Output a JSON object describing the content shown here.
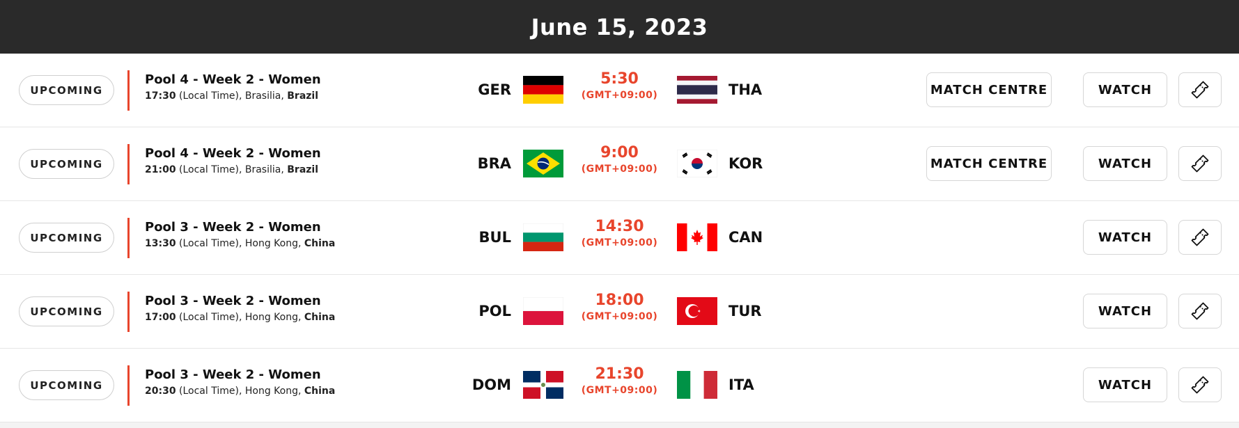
{
  "header": {
    "date": "June 15, 2023"
  },
  "labels": {
    "local_time": "(Local Time)",
    "match_centre": "MATCH CENTRE",
    "watch": "WATCH"
  },
  "colors": {
    "accent": "#e8452c",
    "header_bg": "#2a2a2a"
  },
  "matches": [
    {
      "status": "UPCOMING",
      "title": "Pool 4 - Week 2 - Women",
      "local_time": "17:30",
      "city": "Brasilia",
      "country": "Brazil",
      "team_a": "GER",
      "team_b": "THA",
      "time": "5:30",
      "tz": "(GMT+09:00)",
      "has_match_centre": true
    },
    {
      "status": "UPCOMING",
      "title": "Pool 4 - Week 2 - Women",
      "local_time": "21:00",
      "city": "Brasilia",
      "country": "Brazil",
      "team_a": "BRA",
      "team_b": "KOR",
      "time": "9:00",
      "tz": "(GMT+09:00)",
      "has_match_centre": true
    },
    {
      "status": "UPCOMING",
      "title": "Pool 3 - Week 2 - Women",
      "local_time": "13:30",
      "city": "Hong Kong",
      "country": "China",
      "team_a": "BUL",
      "team_b": "CAN",
      "time": "14:30",
      "tz": "(GMT+09:00)",
      "has_match_centre": false
    },
    {
      "status": "UPCOMING",
      "title": "Pool 3 - Week 2 - Women",
      "local_time": "17:00",
      "city": "Hong Kong",
      "country": "China",
      "team_a": "POL",
      "team_b": "TUR",
      "time": "18:00",
      "tz": "(GMT+09:00)",
      "has_match_centre": false
    },
    {
      "status": "UPCOMING",
      "title": "Pool 3 - Week 2 - Women",
      "local_time": "20:30",
      "city": "Hong Kong",
      "country": "China",
      "team_a": "DOM",
      "team_b": "ITA",
      "time": "21:30",
      "tz": "(GMT+09:00)",
      "has_match_centre": false
    }
  ]
}
